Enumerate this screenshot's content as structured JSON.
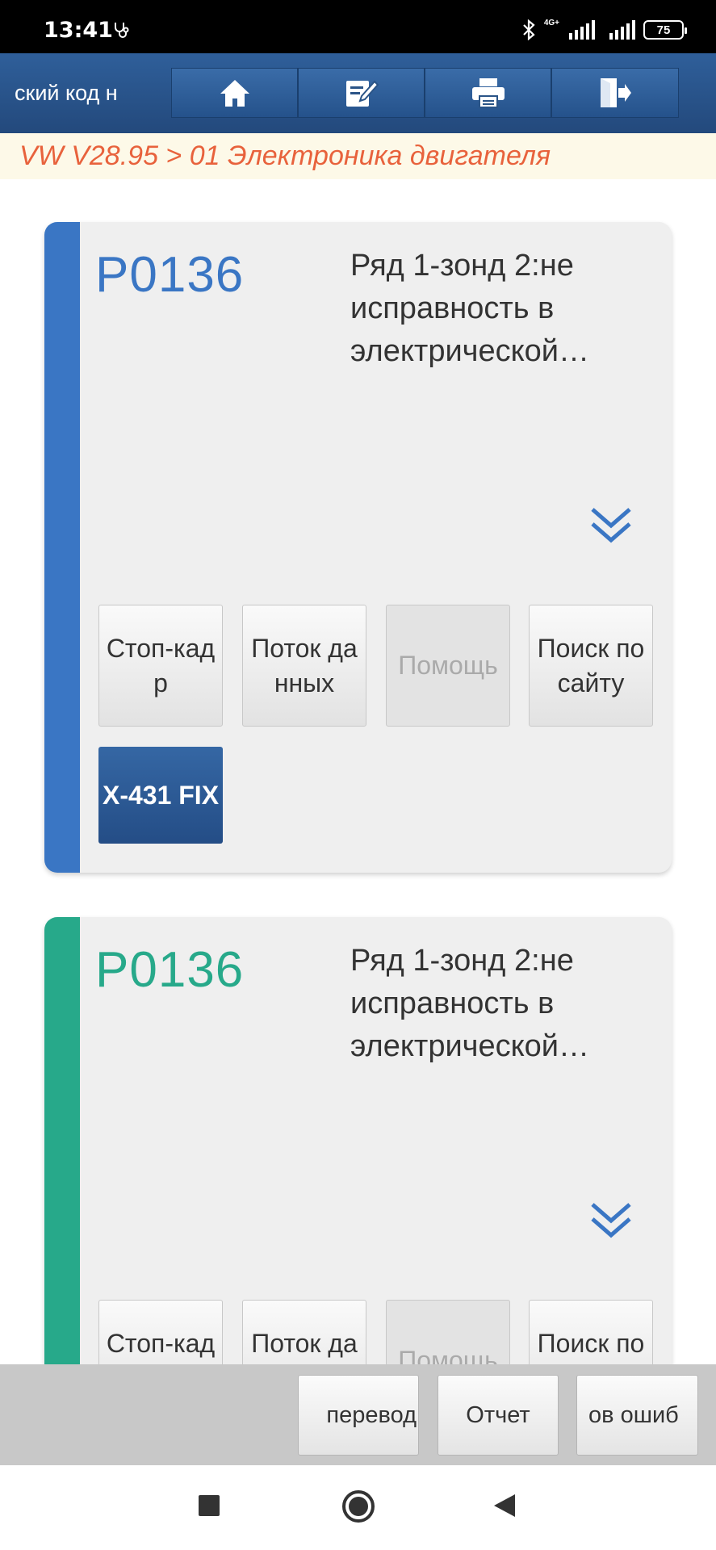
{
  "status_bar": {
    "time": "13:41",
    "network": "4G+",
    "battery": "75",
    "icons": [
      "stethoscope-icon",
      "bluetooth-icon",
      "signal-icon",
      "signal-icon",
      "battery-icon"
    ]
  },
  "toolbar": {
    "title": "ский код н",
    "buttons": [
      {
        "name": "home-icon"
      },
      {
        "name": "edit-icon"
      },
      {
        "name": "print-icon"
      },
      {
        "name": "exit-icon"
      }
    ]
  },
  "breadcrumb": "VW V28.95 > 01 Электроника двигателя",
  "cards": [
    {
      "code": "P0136",
      "accent": "#3a76c4",
      "description": "Ряд 1-зонд 2:не исправность в электрической…",
      "buttons": [
        "Стоп-кадр",
        "Поток данных",
        "Помощь",
        "Поиск по сайту"
      ],
      "fix_label": "X-431 FIX"
    },
    {
      "code": "P0136",
      "accent": "#27a98a",
      "description": "Ряд 1-зонд 2:не исправность в электрической…",
      "buttons": [
        "Стоп-кадр",
        "Поток данных",
        "Помощь",
        "Поиск по сайту"
      ]
    }
  ],
  "action_bar": {
    "buttons": [
      "перевод",
      "Отчет",
      "ов ошиб"
    ]
  },
  "colors": {
    "toolbar": "#2a5487",
    "breadcrumb_text": "#e8623c",
    "breadcrumb_bg": "#fdf9e8",
    "card_bg": "#efefef"
  }
}
